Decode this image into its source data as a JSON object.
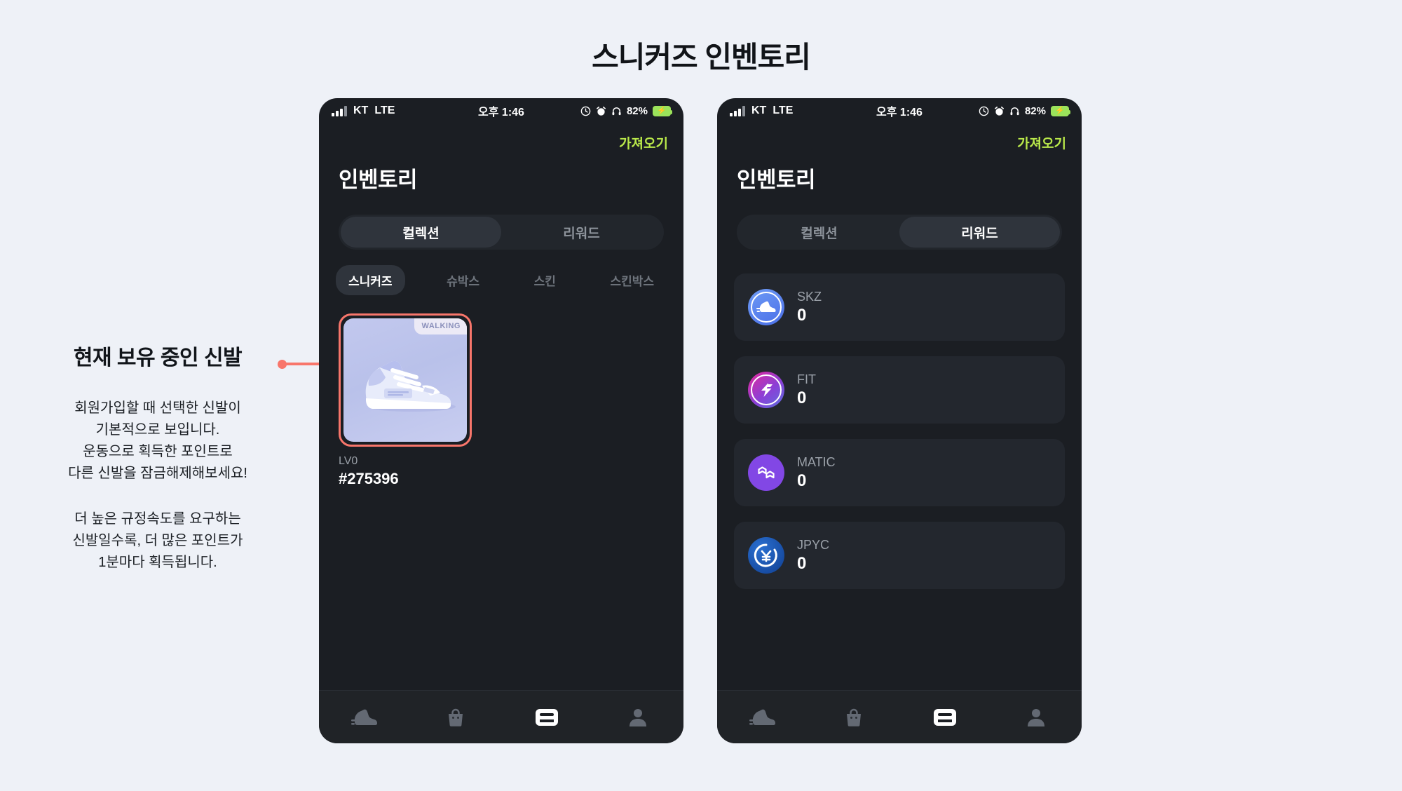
{
  "page": {
    "title": "스니커즈 인벤토리",
    "background_color": "#eef1f7"
  },
  "annotation": {
    "title": "현재 보유 중인 신발",
    "paragraph1": "회원가입할 때 선택한 신발이\n기본적으로 보입니다.\n운동으로 획득한 포인트로\n다른 신발을 잠금해제해보세요!",
    "paragraph2": "더 높은 규정속도를 요구하는\n신발일수록, 더 많은 포인트가\n1분마다 획득됩니다.",
    "connector_color": "#f8766b"
  },
  "statusbar": {
    "carrier": "KT",
    "network": "LTE",
    "time": "오후 1:46",
    "battery_percent": "82%",
    "icons": [
      "signal-icon",
      "stopwatch-icon",
      "alarm-icon",
      "headphones-icon",
      "battery-charging-icon"
    ]
  },
  "header": {
    "import_label": "가져오기",
    "import_color": "#b9e84a",
    "screen_title": "인벤토리"
  },
  "segments": [
    {
      "label": "컬렉션"
    },
    {
      "label": "리워드"
    }
  ],
  "subtabs": [
    {
      "label": "스니커즈"
    },
    {
      "label": "슈박스"
    },
    {
      "label": "스킨"
    },
    {
      "label": "스킨박스"
    }
  ],
  "left_phone": {
    "active_segment": "컬렉션",
    "active_subtab": "스니커즈",
    "sneaker": {
      "badge": "WALKING",
      "level": "LV0",
      "id": "#275396",
      "highlight_color": "#f8766b"
    }
  },
  "right_phone": {
    "active_segment": "리워드",
    "rewards": [
      {
        "name": "SKZ",
        "value": "0",
        "icon": "sneaker-coin-icon",
        "color": "#4a6fe8"
      },
      {
        "name": "FIT",
        "value": "0",
        "icon": "lightning-coin-icon",
        "color": "#e5289a"
      },
      {
        "name": "MATIC",
        "value": "0",
        "icon": "polygon-coin-icon",
        "color": "#8247e5"
      },
      {
        "name": "JPYC",
        "value": "0",
        "icon": "yen-coin-icon",
        "color": "#103f92"
      }
    ]
  },
  "bottom_nav": [
    {
      "icon": "sneaker-icon",
      "active": false
    },
    {
      "icon": "shopping-bag-icon",
      "active": false
    },
    {
      "icon": "wallet-icon",
      "active": true
    },
    {
      "icon": "person-icon",
      "active": false
    }
  ]
}
